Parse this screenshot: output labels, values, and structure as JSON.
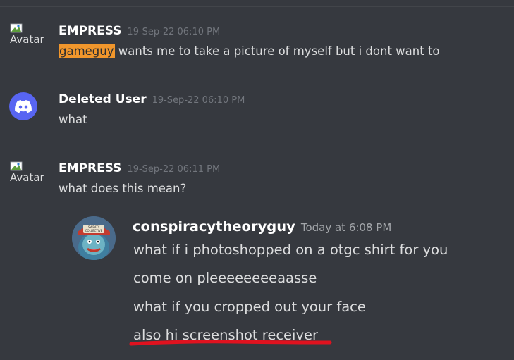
{
  "messages": [
    {
      "author": "EMPRESS",
      "timestamp": "19-Sep-22 06:10 PM",
      "avatar_alt": "Avatar",
      "mention": "gameguy",
      "text_after_mention": " wants me to take a picture of myself but i dont want to"
    },
    {
      "author": "Deleted User",
      "timestamp": "19-Sep-22 06:10 PM",
      "avatar_icon": "discord-logo-icon",
      "text": "what"
    },
    {
      "author": "EMPRESS",
      "timestamp": "19-Sep-22 06:11 PM",
      "avatar_alt": "Avatar",
      "text": "what does this mean?"
    }
  ],
  "embedded_screenshot": {
    "author": "conspiracytheoryguy",
    "timestamp": "Today at 6:08 PM",
    "lines": [
      "what if i photoshopped on a otgc shirt for you",
      "come on pleeeeeeeeaasse",
      "what if you cropped out your face",
      "also hi screenshot receiver"
    ],
    "hat_text": "SWEATY COLLECTIVE"
  },
  "colors": {
    "background": "#36393f",
    "mention_highlight": "#f0962c",
    "discord_blurple": "#5865f2",
    "underline": "#e0121f"
  }
}
